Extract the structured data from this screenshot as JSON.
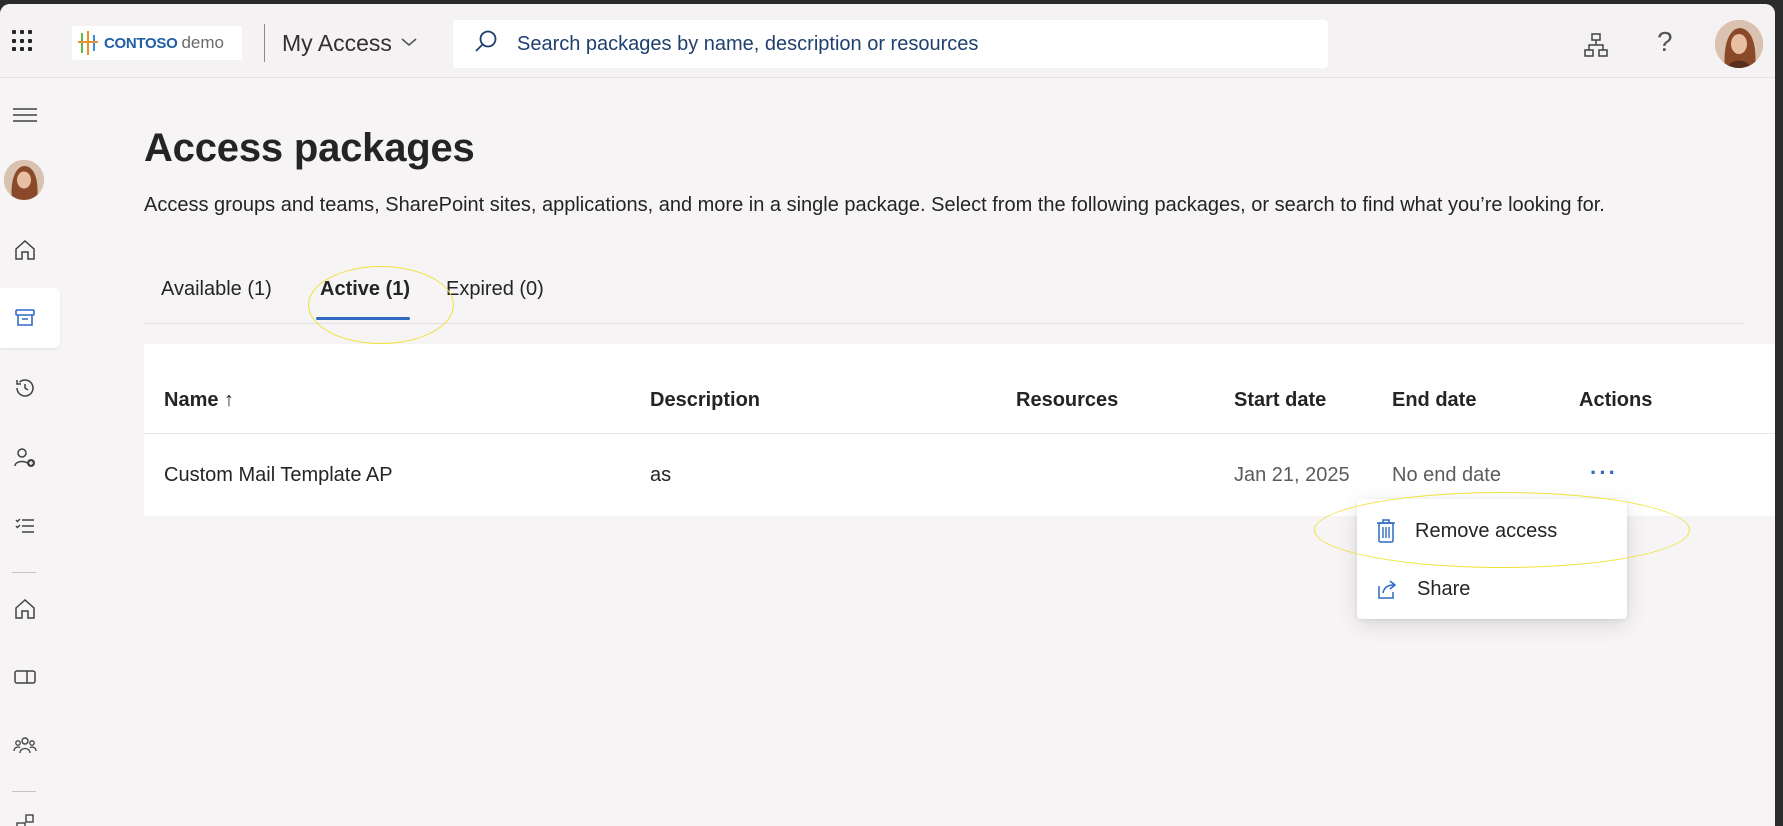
{
  "header": {
    "brand": "CONTOSO",
    "brand_suffix": "demo",
    "app_name": "My Access",
    "search_placeholder": "Search packages by name, description or resources",
    "help_label": "?"
  },
  "page": {
    "title": "Access packages",
    "subtitle": "Access groups and teams, SharePoint sites, applications, and more in a single package. Select from the following packages, or search to find what you’re looking for."
  },
  "tabs": [
    {
      "label": "Available (1)"
    },
    {
      "label": "Active (1)"
    },
    {
      "label": "Expired (0)"
    }
  ],
  "table": {
    "columns": [
      "Name ↑",
      "Description",
      "Resources",
      "Start date",
      "End date",
      "Actions"
    ],
    "rows": [
      {
        "name": "Custom Mail Template AP",
        "description": "as",
        "resources": "",
        "start_date": "Jan 21, 2025",
        "end_date": "No end date",
        "actions": "···"
      }
    ]
  },
  "context_menu": {
    "items": [
      {
        "label": "Remove access",
        "icon": "trash-icon"
      },
      {
        "label": "Share",
        "icon": "share-icon"
      }
    ]
  },
  "colors": {
    "accent": "#2e6ac4",
    "highlight": "#f0e23a",
    "brand": "#1e5fa6"
  }
}
